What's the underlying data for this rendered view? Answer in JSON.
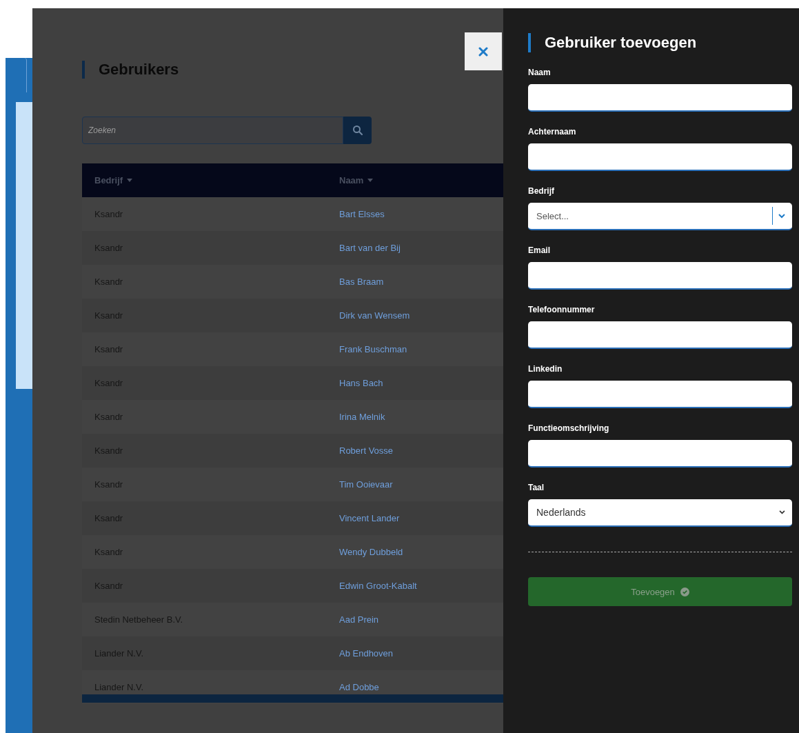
{
  "users_panel": {
    "title": "Gebruikers",
    "search": {
      "placeholder": "Zoeken"
    },
    "table": {
      "columns": [
        "Bedrijf",
        "Naam"
      ],
      "rows": [
        {
          "company": "Ksandr",
          "name": "Bart Elsses"
        },
        {
          "company": "Ksandr",
          "name": "Bart van der Bij"
        },
        {
          "company": "Ksandr",
          "name": "Bas Braam"
        },
        {
          "company": "Ksandr",
          "name": "Dirk van Wensem"
        },
        {
          "company": "Ksandr",
          "name": "Frank Buschman"
        },
        {
          "company": "Ksandr",
          "name": "Hans Bach"
        },
        {
          "company": "Ksandr",
          "name": "Irina Melnik"
        },
        {
          "company": "Ksandr",
          "name": "Robert Vosse"
        },
        {
          "company": "Ksandr",
          "name": "Tim Ooievaar"
        },
        {
          "company": "Ksandr",
          "name": "Vincent Lander"
        },
        {
          "company": "Ksandr",
          "name": "Wendy Dubbeld"
        },
        {
          "company": "Ksandr",
          "name": "Edwin Groot-Kabalt"
        },
        {
          "company": "Stedin Netbeheer B.V.",
          "name": "Aad Prein"
        },
        {
          "company": "Liander N.V.",
          "name": "Ab Endhoven"
        },
        {
          "company": "Liander N.V.",
          "name": "Ad Dobbe"
        }
      ]
    }
  },
  "drawer": {
    "title": "Gebruiker toevoegen",
    "fields": [
      {
        "kind": "text",
        "label": "Naam"
      },
      {
        "kind": "text",
        "label": "Achternaam"
      },
      {
        "kind": "combo",
        "label": "Bedrijf",
        "placeholder": "Select..."
      },
      {
        "kind": "text",
        "label": "Email"
      },
      {
        "kind": "text",
        "label": "Telefoonnummer"
      },
      {
        "kind": "text",
        "label": "Linkedin"
      },
      {
        "kind": "text",
        "label": "Functieomschrijving"
      },
      {
        "kind": "select",
        "label": "Taal",
        "value": "Nederlands"
      }
    ],
    "submit": "Toevoegen"
  }
}
